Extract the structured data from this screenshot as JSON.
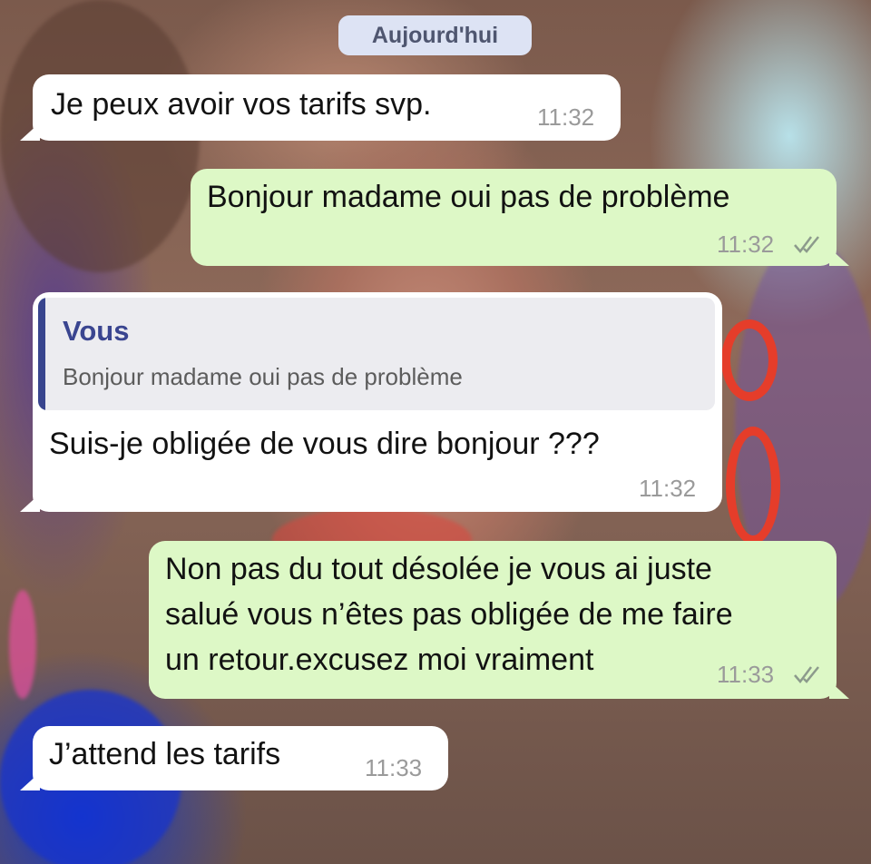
{
  "date_chip": "Aujourd'hui",
  "messages": [
    {
      "direction": "in",
      "text": "Je peux avoir vos tarifs svp.",
      "time": "11:32"
    },
    {
      "direction": "out",
      "text": "Bonjour madame oui pas de problème",
      "time": "11:32",
      "status": "read"
    },
    {
      "direction": "in",
      "reply_to": {
        "author": "Vous",
        "text": "Bonjour madame oui pas de problème"
      },
      "text": "Suis-je obligée de vous dire bonjour ???",
      "time": "11:32"
    },
    {
      "direction": "out",
      "text": "Non pas du tout désolée je vous ai juste\nsalué vous n’êtes pas obligée de me faire\nun retour.excusez moi vraiment",
      "time": "11:33",
      "status": "read"
    },
    {
      "direction": "in",
      "text": "J’attend les tarifs",
      "time": "11:33"
    }
  ],
  "colors": {
    "incoming_bubble": "#ffffff",
    "outgoing_bubble": "#ddf8c6",
    "quote_accent": "#38458e",
    "date_chip": "#dde3f4"
  },
  "icons": {
    "read_receipt": "double-check-icon"
  }
}
